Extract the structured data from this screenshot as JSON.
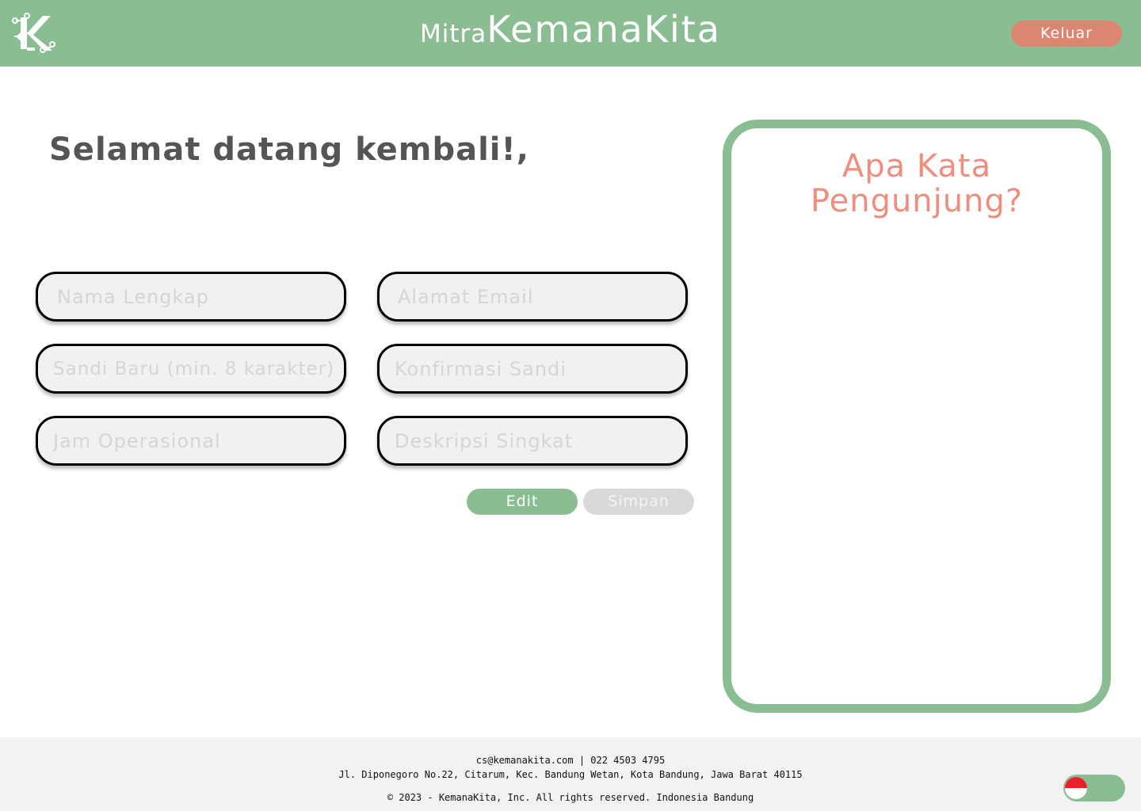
{
  "header": {
    "brand_small": "Mitra",
    "brand_big": "KemanaKita",
    "logout_label": "Keluar",
    "colors": {
      "bar": "#8abd92",
      "logout": "#dc8672"
    }
  },
  "main": {
    "welcome": "Selamat datang kembali!,",
    "fields": {
      "full_name_placeholder": "Nama Lengkap",
      "email_placeholder": "Alamat Email",
      "new_password_placeholder": "Sandi Baru (min. 8 karakter)",
      "confirm_password_placeholder": "Konfirmasi Sandi",
      "hours_placeholder": "Jam Operasional",
      "description_placeholder": "Deskripsi Singkat"
    },
    "edit_label": "Edit",
    "save_label": "Simpan"
  },
  "reviews": {
    "title_line1": "Apa Kata",
    "title_line2": "Pengunjung?",
    "accent": "#ef8e7e"
  },
  "footer": {
    "contact": "cs@kemanakita.com | 022 4503 4795",
    "address": "Jl. Diponegoro No.22, Citarum, Kec. Bandung Wetan, Kota Bandung, Jawa Barat 40115",
    "copyright": "© 2023 - KemanaKita, Inc. All rights reserved. Indonesia Bandung"
  },
  "language_toggle": {
    "flag": "indonesia-flag-icon"
  }
}
